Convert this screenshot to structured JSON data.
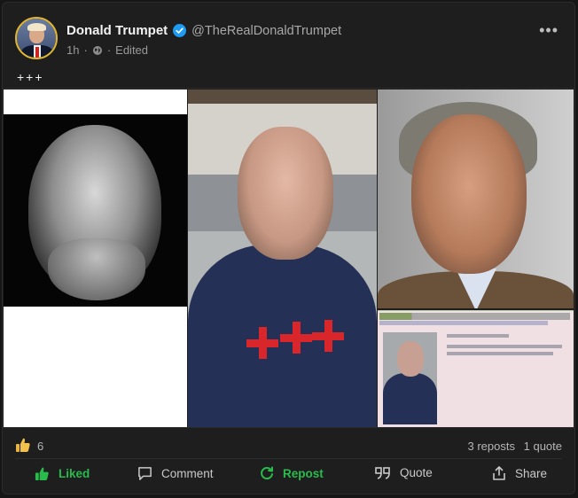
{
  "author": {
    "display_name": "Donald Trumpet",
    "handle": "@TheRealDonaldTrumpet",
    "verified": true
  },
  "meta": {
    "time": "1h",
    "separator": "·",
    "edited": "Edited",
    "visibility_icon": "globe-icon"
  },
  "post": {
    "text": "+++"
  },
  "engagement": {
    "like_count": "6",
    "reposts": "3 reposts",
    "quotes": "1 quote"
  },
  "actions": {
    "like": "Liked",
    "comment": "Comment",
    "repost": "Repost",
    "quote": "Quote",
    "share": "Share"
  },
  "colors": {
    "background": "#1e1e1f",
    "accent_green": "#29bb4c",
    "verified_blue": "#1d9bf0",
    "avatar_ring": "#e2b62c"
  }
}
